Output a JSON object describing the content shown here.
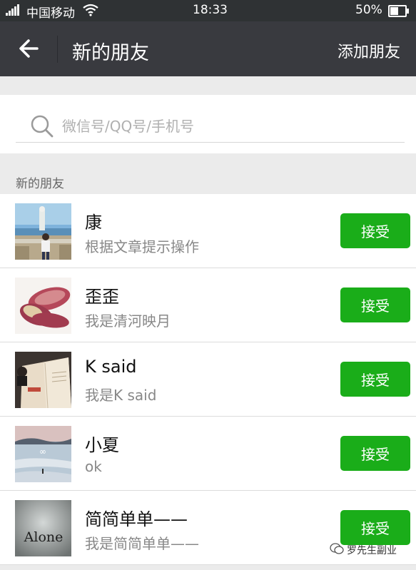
{
  "status_bar": {
    "carrier": "中国移动",
    "time": "18:33",
    "battery": "50%",
    "battery_level": 0.5,
    "icons": [
      "signal-icon",
      "wifi-icon",
      "battery-icon"
    ]
  },
  "title_bar": {
    "back_icon": "arrow-left-icon",
    "title": "新的朋友",
    "action": "添加朋友"
  },
  "search": {
    "icon": "search-icon",
    "placeholder": "微信号/QQ号/手机号",
    "value": ""
  },
  "section_header": "新的朋友",
  "friend_requests": [
    {
      "name": "康",
      "message": "根据文章提示操作",
      "button": "接受"
    },
    {
      "name": "歪歪",
      "message": "我是清河映月",
      "button": "接受"
    },
    {
      "name": "K said",
      "message": "我是K said",
      "button": "接受"
    },
    {
      "name": "小夏",
      "message": "ok",
      "button": "接受"
    },
    {
      "name": "简简单单——",
      "message": "我是简简单单——",
      "button": "接受",
      "avatar_text": "Alone"
    }
  ],
  "watermark": "罗先生副业",
  "colors": {
    "title_bar": "#393a3f",
    "status_bar": "#2f3234",
    "accept_button": "#1aad19",
    "background": "#ebebeb"
  }
}
